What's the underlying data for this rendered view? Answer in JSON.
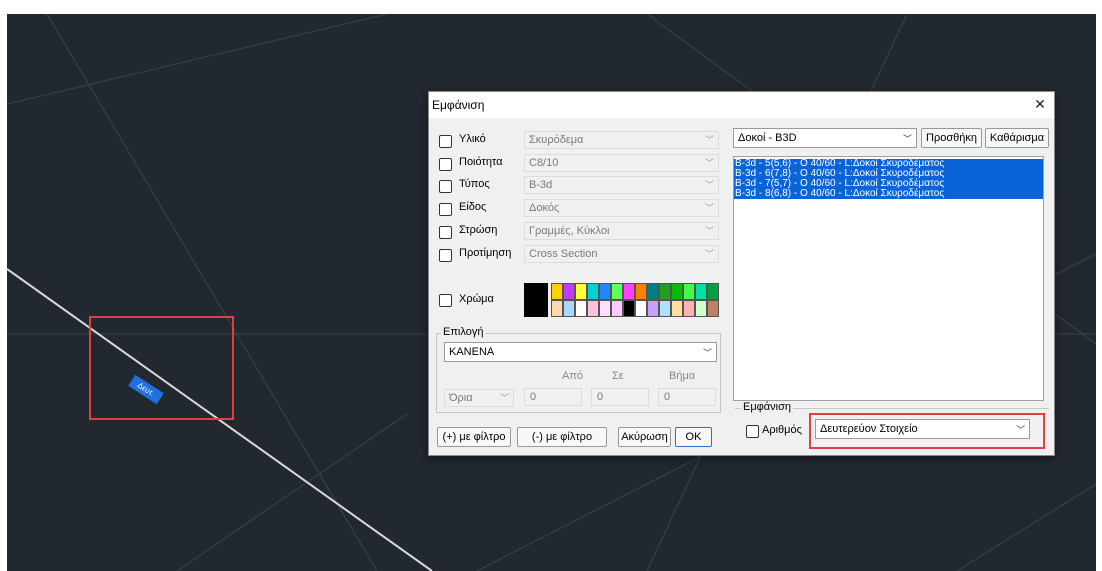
{
  "canvas": {
    "beam_label": "Δευτ.",
    "background_color": "#212830"
  },
  "dialog": {
    "title": "Εμφάνιση",
    "close_glyph": "✕",
    "properties": [
      {
        "label": "Υλικό",
        "value": "Σκυρόδεμα"
      },
      {
        "label": "Ποιότητα",
        "value": "C8/10"
      },
      {
        "label": "Τύπος",
        "value": "B-3d"
      },
      {
        "label": "Είδος",
        "value": "Δοκός"
      },
      {
        "label": "Στρώση",
        "value": "Γραμμές, Κύκλοι"
      },
      {
        "label": "Προτίμηση",
        "value": "Cross Section"
      }
    ],
    "color_label": "Χρώμα",
    "selection_group": {
      "label": "Επιλογή",
      "value": "ΚΑΝΕΝΑ",
      "from_label": "Από",
      "to_label": "Σε",
      "step_label": "Βήμα",
      "limits_value": "Όρια",
      "from_value": "0",
      "to_value": "0",
      "step_value": "0"
    },
    "buttons": {
      "with_filter_plus": "(+) με φίλτρο",
      "with_filter_minus": "(-) με φίλτρο",
      "cancel": "Ακύρωση",
      "ok": "OK",
      "add": "Προσθήκη",
      "clear": "Καθάρισμα"
    },
    "element_type": "Δοκοί - B3D",
    "element_list": [
      "B-3d - 5(5,6) - O 40/60 - L:Δοκοί Σκυροδέματος",
      "B-3d - 6(7,8) - O 40/60 - L:Δοκοί Σκυροδέματος",
      "B-3d - 7(5,7) - O 40/60 - L:Δοκοί Σκυροδέματος",
      "B-3d - 8(6,8) - O 40/60 - L:Δοκοί Σκυροδέματος"
    ],
    "display_group": {
      "label": "Εμφάνιση",
      "number_label": "Αριθμός",
      "mode_value": "Δευτερεύον Στοιχείο"
    }
  },
  "colors": {
    "highlight": "#e04040",
    "selection": "#0a64d8",
    "swatches_row1": [
      "#ffd000",
      "#c03aff",
      "#ffff40",
      "#00d0d0",
      "#1e88ff",
      "#60ff60",
      "#ff40ff",
      "#ff8000",
      "#008080",
      "#20a020",
      "#00c000",
      "#40ff40",
      "#00e0a0",
      "#00a040"
    ],
    "swatches_row2": [
      "#ffd8b0",
      "#a8d8ff",
      "#ffffff",
      "#ffc0e0",
      "#ffe0ff",
      "#ffc8ff",
      "#000000",
      "#ffffff",
      "#c8a0ff",
      "#b0e0ff",
      "#ffe0a0",
      "#ffb0b0",
      "#d0ffd0",
      "#c08060"
    ]
  }
}
